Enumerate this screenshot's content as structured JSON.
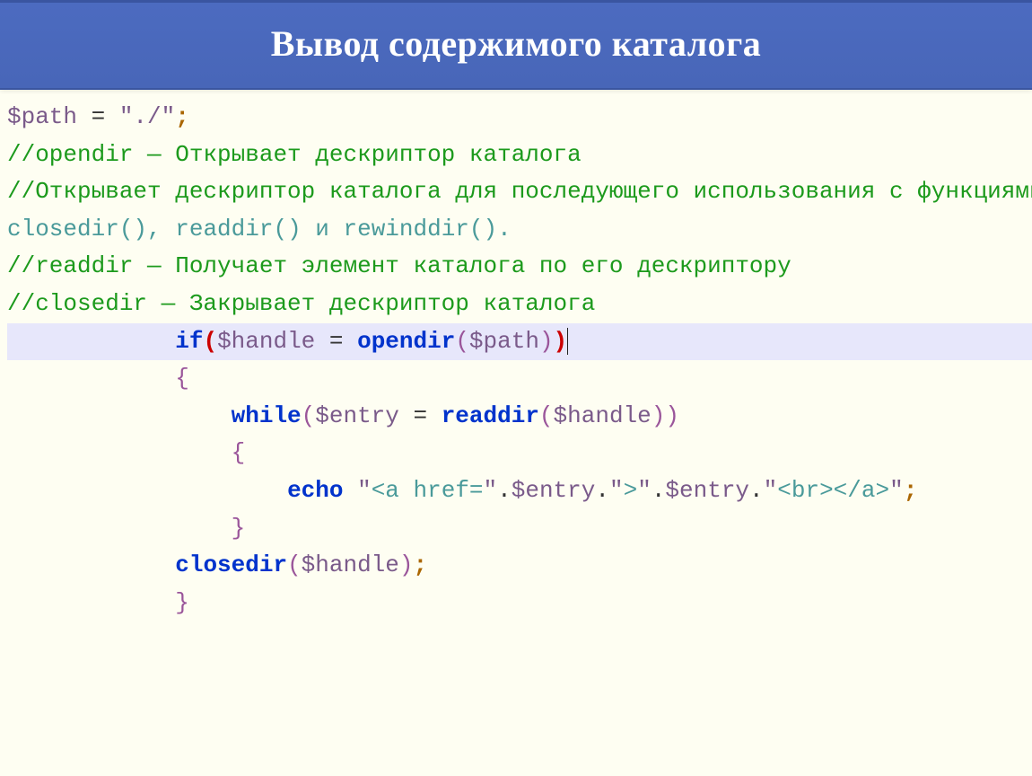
{
  "header": {
    "title": "Вывод содержимого каталога"
  },
  "code": {
    "l1": {
      "var": "$path",
      "eq": " = ",
      "str": "\"./\"",
      "semi": ";"
    },
    "l2": "//opendir — Открывает дескриптор каталога",
    "l3": "//Открывает дескриптор каталога для последующего использования с функциями",
    "l4": {
      "fn1": "closedir",
      "p1": "(), ",
      "fn2": "readdir",
      "p2": "() и ",
      "fn3": "rewinddir",
      "p3": "()."
    },
    "l5": "//readdir — Получает элемент каталога по его дескриптору",
    "l6": "//closedir — Закрывает дескриптор каталога",
    "l7": {
      "kw": "if",
      "lp": "(",
      "var1": "$handle",
      "eq": " = ",
      "fn": "opendir",
      "lp2": "(",
      "var2": "$path",
      "rp2": ")",
      "rp": ")"
    },
    "l8": "{",
    "l9": {
      "kw": "while",
      "lp": "(",
      "var1": "$entry",
      "eq": " = ",
      "fn": "readdir",
      "lp2": "(",
      "var2": "$handle",
      "rp2": ")",
      "rp": ")"
    },
    "l10": "{",
    "l11": {
      "kw": "echo",
      "sp": " ",
      "q1": "\"",
      "html1": "<a href=",
      "q2": "\"",
      "dot1": ".",
      "var1": "$entry",
      "dot2": ".",
      "q3": "\"",
      "html2": ">",
      "q4": "\"",
      "dot3": ".",
      "var2": "$entry",
      "dot4": ".",
      "q5": "\"",
      "html3": "<br></a>",
      "q6": "\"",
      "semi": ";"
    },
    "l12": "}",
    "l13": {
      "fn": "closedir",
      "lp": "(",
      "var": "$handle",
      "rp": ")",
      "semi": ";"
    },
    "l14": "}"
  }
}
